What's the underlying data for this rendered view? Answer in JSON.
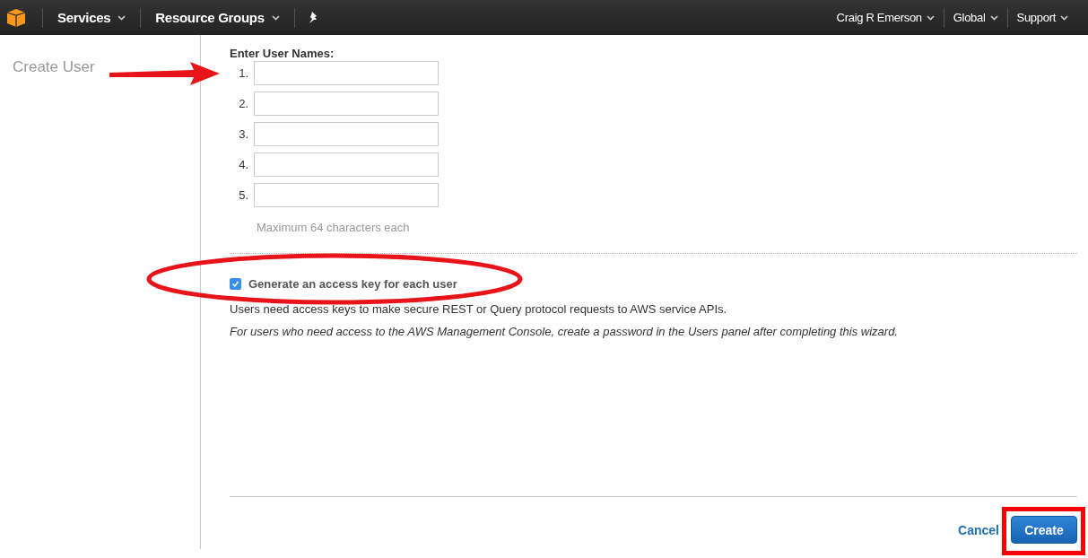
{
  "nav": {
    "left": [
      {
        "label": "Services"
      },
      {
        "label": "Resource Groups"
      }
    ],
    "right": [
      {
        "label": "Craig R Emerson"
      },
      {
        "label": "Global"
      },
      {
        "label": "Support"
      }
    ]
  },
  "sidebar": {
    "title": "Create User"
  },
  "form": {
    "heading": "Enter User Names:",
    "fields": [
      {
        "number": "1."
      },
      {
        "number": "2."
      },
      {
        "number": "3."
      },
      {
        "number": "4."
      },
      {
        "number": "5."
      }
    ],
    "hint": "Maximum 64 characters each",
    "access_key": {
      "label": "Generate an access key for each user",
      "checked": true
    },
    "note": "Users need access keys to make secure REST or Query protocol requests to AWS service APIs.",
    "note_italic": "For users who need access to the AWS Management Console, create a password in the Users panel after completing this wizard."
  },
  "buttons": {
    "cancel": "Cancel",
    "create": "Create"
  }
}
